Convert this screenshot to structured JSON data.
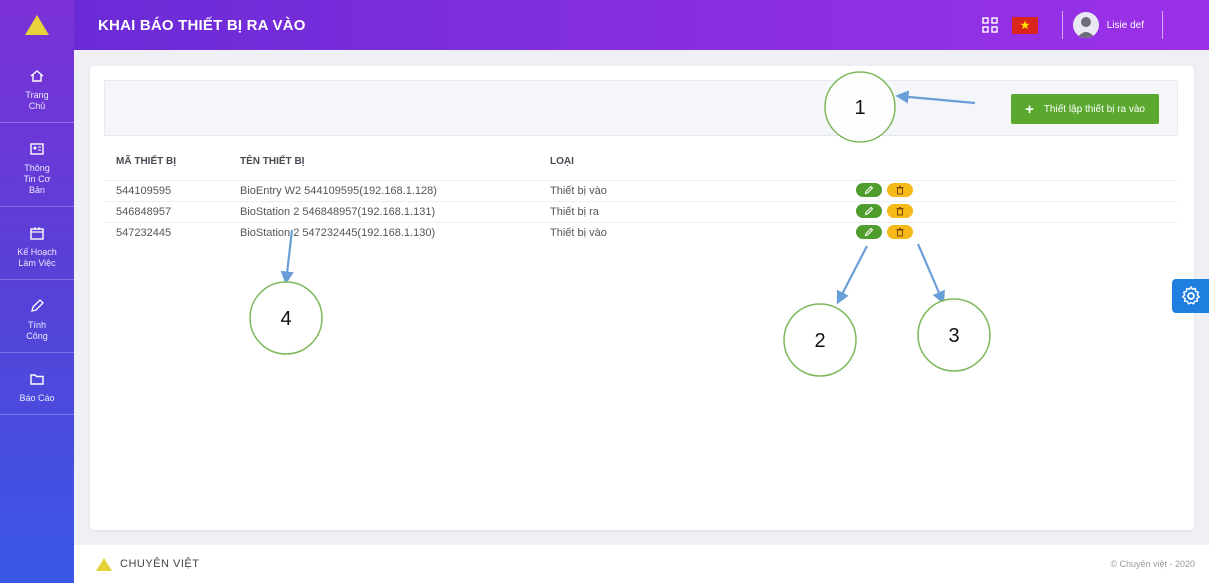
{
  "header": {
    "title": "KHAI BÁO THIẾT BỊ RA VÀO",
    "username": "Lisie def"
  },
  "sidebar": {
    "items": [
      {
        "label": "Trang\nChủ",
        "icon": "home-icon"
      },
      {
        "label": "Thông\nTin Cơ\nBản",
        "icon": "id-card-icon"
      },
      {
        "label": "Kế Hoạch\nLàm Việc",
        "icon": "calendar-icon"
      },
      {
        "label": "Tính\nCông",
        "icon": "pencil-icon"
      },
      {
        "label": "Báo Cáo",
        "icon": "folder-icon"
      }
    ]
  },
  "toolbar": {
    "add_label": "Thiết lập thiết bị ra vào"
  },
  "table": {
    "headers": [
      "MÃ THIẾT BỊ",
      "TÊN THIẾT BỊ",
      "LOẠI"
    ],
    "rows": [
      {
        "code": "544109595",
        "name": "BioEntry W2 544109595(192.168.1.128)",
        "type": "Thiết bị vào"
      },
      {
        "code": "546848957",
        "name": "BioStation 2 546848957(192.168.1.131)",
        "type": "Thiết bị ra"
      },
      {
        "code": "547232445",
        "name": "BioStation 2 547232445(192.168.1.130)",
        "type": "Thiết bị vào"
      }
    ]
  },
  "annotations": {
    "n1": "1",
    "n2": "2",
    "n3": "3",
    "n4": "4"
  },
  "footer": {
    "brand": "CHUYÊN VIỆT",
    "copyright": "© Chuyên việt - 2020"
  },
  "colors": {
    "sidebar_top": "#7b31d6",
    "sidebar_bottom": "#3a58e6",
    "header": "#8a2fe0",
    "add_button": "#5aa82e",
    "edit_button": "#4f9d2d",
    "delete_button": "#f5b91a",
    "annotation": "#6a9ed8",
    "settings_tab": "#1f7fe0"
  }
}
